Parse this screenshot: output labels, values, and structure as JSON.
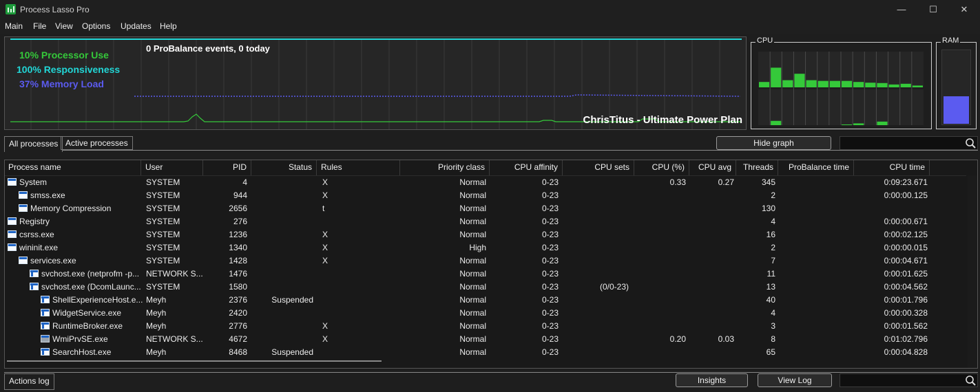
{
  "window": {
    "title": "Process Lasso Pro",
    "minimize": "—",
    "maximize": "☐",
    "close": "✕"
  },
  "menu": [
    "Main",
    "File",
    "View",
    "Options",
    "Updates",
    "Help"
  ],
  "graph": {
    "processor_use": "10% Processor Use",
    "responsiveness": "100% Responsiveness",
    "memory_load": "37% Memory Load",
    "probalance_events": "0 ProBalance events, 0 today",
    "power_plan": "ChrisTitus - Ultimate Power Plan",
    "colors": {
      "processor": "#35c93a",
      "responsiveness": "#22d7d7",
      "memory": "#5b5bf0"
    }
  },
  "cpu_box": {
    "label": "CPU",
    "top_levels": [
      0.15,
      0.55,
      0.2,
      0.38,
      0.2,
      0.18,
      0.18,
      0.18,
      0.15,
      0.13,
      0.12,
      0.08,
      0.1,
      0.05
    ],
    "bottom_levels": [
      0.0,
      0.12,
      0.0,
      0.0,
      0.0,
      0.0,
      0.0,
      0.02,
      0.05,
      0.0,
      0.1,
      0.0,
      0.0,
      0.0
    ]
  },
  "ram_box": {
    "label": "RAM",
    "level": 0.37
  },
  "tabs": {
    "all": "All processes",
    "active": "Active processes"
  },
  "hide_graph": "Hide graph",
  "columns": [
    "Process name",
    "User",
    "PID",
    "Status",
    "Rules",
    "Priority class",
    "CPU affinity",
    "CPU sets",
    "CPU (%)",
    "CPU avg",
    "Threads",
    "ProBalance time",
    "CPU time"
  ],
  "rows": [
    {
      "indent": 0,
      "icon": "window-icon",
      "name": "System",
      "user": "SYSTEM",
      "pid": "4",
      "status": "",
      "rules": "X",
      "priority": "Normal",
      "affinity": "0-23",
      "sets": "",
      "cpu": "0.33",
      "avg": "0.27",
      "threads": "345",
      "probal": "",
      "time": "0:09:23.671"
    },
    {
      "indent": 1,
      "icon": "window-icon",
      "name": "smss.exe",
      "user": "SYSTEM",
      "pid": "944",
      "status": "",
      "rules": "X",
      "priority": "Normal",
      "affinity": "0-23",
      "sets": "",
      "cpu": "",
      "avg": "",
      "threads": "2",
      "probal": "",
      "time": "0:00:00.125"
    },
    {
      "indent": 1,
      "icon": "window-icon",
      "name": "Memory Compression",
      "user": "SYSTEM",
      "pid": "2656",
      "status": "",
      "rules": "t",
      "priority": "Normal",
      "affinity": "0-23",
      "sets": "",
      "cpu": "",
      "avg": "",
      "threads": "130",
      "probal": "",
      "time": ""
    },
    {
      "indent": 0,
      "icon": "window-icon",
      "name": "Registry",
      "user": "SYSTEM",
      "pid": "276",
      "status": "",
      "rules": "",
      "priority": "Normal",
      "affinity": "0-23",
      "sets": "",
      "cpu": "",
      "avg": "",
      "threads": "4",
      "probal": "",
      "time": "0:00:00.671"
    },
    {
      "indent": 0,
      "icon": "window-icon",
      "name": "csrss.exe",
      "user": "SYSTEM",
      "pid": "1236",
      "status": "",
      "rules": "X",
      "priority": "Normal",
      "affinity": "0-23",
      "sets": "",
      "cpu": "",
      "avg": "",
      "threads": "16",
      "probal": "",
      "time": "0:00:02.125"
    },
    {
      "indent": 0,
      "icon": "window-icon",
      "name": "wininit.exe",
      "user": "SYSTEM",
      "pid": "1340",
      "status": "",
      "rules": "X",
      "priority": "High",
      "affinity": "0-23",
      "sets": "",
      "cpu": "",
      "avg": "",
      "threads": "2",
      "probal": "",
      "time": "0:00:00.015"
    },
    {
      "indent": 1,
      "icon": "window-icon",
      "name": "services.exe",
      "user": "SYSTEM",
      "pid": "1428",
      "status": "",
      "rules": "X",
      "priority": "Normal",
      "affinity": "0-23",
      "sets": "",
      "cpu": "",
      "avg": "",
      "threads": "7",
      "probal": "",
      "time": "0:00:04.671"
    },
    {
      "indent": 2,
      "icon": "service-icon",
      "name": "svchost.exe (netprofm -p...",
      "user": "NETWORK S...",
      "pid": "1476",
      "status": "",
      "rules": "",
      "priority": "Normal",
      "affinity": "0-23",
      "sets": "",
      "cpu": "",
      "avg": "",
      "threads": "11",
      "probal": "",
      "time": "0:00:01.625"
    },
    {
      "indent": 2,
      "icon": "service-icon",
      "name": "svchost.exe (DcomLaunc...",
      "user": "SYSTEM",
      "pid": "1580",
      "status": "",
      "rules": "",
      "priority": "Normal",
      "affinity": "0-23",
      "sets": "(0/0-23)",
      "cpu": "",
      "avg": "",
      "threads": "13",
      "probal": "",
      "time": "0:00:04.562"
    },
    {
      "indent": 3,
      "icon": "service-icon",
      "name": "ShellExperienceHost.e...",
      "user": "Meyh",
      "pid": "2376",
      "status": "Suspended",
      "rules": "",
      "priority": "Normal",
      "affinity": "0-23",
      "sets": "",
      "cpu": "",
      "avg": "",
      "threads": "40",
      "probal": "",
      "time": "0:00:01.796"
    },
    {
      "indent": 3,
      "icon": "service-icon",
      "name": "WidgetService.exe",
      "user": "Meyh",
      "pid": "2420",
      "status": "",
      "rules": "",
      "priority": "Normal",
      "affinity": "0-23",
      "sets": "",
      "cpu": "",
      "avg": "",
      "threads": "4",
      "probal": "",
      "time": "0:00:00.328"
    },
    {
      "indent": 3,
      "icon": "service-icon",
      "name": "RuntimeBroker.exe",
      "user": "Meyh",
      "pid": "2776",
      "status": "",
      "rules": "X",
      "priority": "Normal",
      "affinity": "0-23",
      "sets": "",
      "cpu": "",
      "avg": "",
      "threads": "3",
      "probal": "",
      "time": "0:00:01.562"
    },
    {
      "indent": 3,
      "icon": "gear-icon",
      "name": "WmiPrvSE.exe",
      "user": "NETWORK S...",
      "pid": "4672",
      "status": "",
      "rules": "X",
      "priority": "Normal",
      "affinity": "0-23",
      "sets": "",
      "cpu": "0.20",
      "avg": "0.03",
      "threads": "8",
      "probal": "",
      "time": "0:01:02.796"
    },
    {
      "indent": 3,
      "icon": "service-icon",
      "name": "SearchHost.exe",
      "user": "Meyh",
      "pid": "8468",
      "status": "Suspended",
      "rules": "",
      "priority": "Normal",
      "affinity": "0-23",
      "sets": "",
      "cpu": "",
      "avg": "",
      "threads": "65",
      "probal": "",
      "time": "0:00:04.828"
    }
  ],
  "bottom": {
    "actions_log": "Actions log",
    "insights": "Insights",
    "view_log": "View Log"
  }
}
